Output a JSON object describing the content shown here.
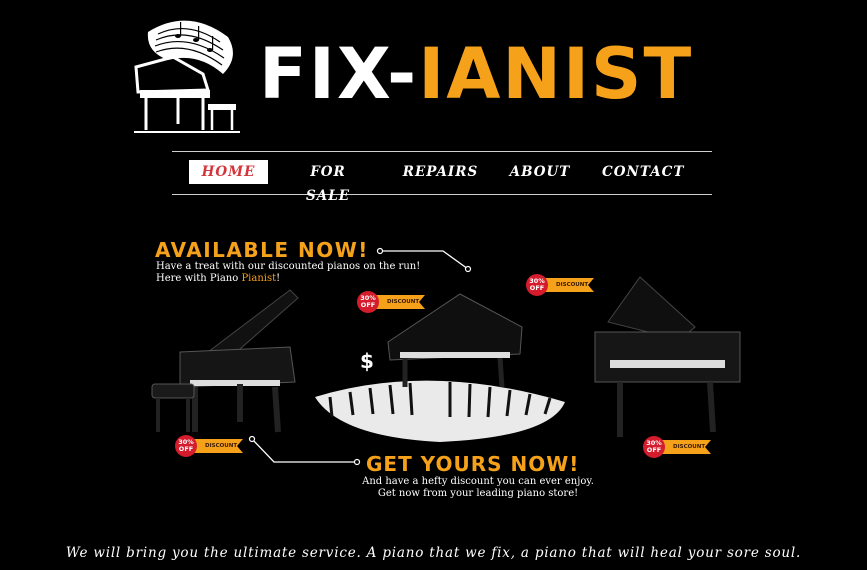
{
  "brand": {
    "part1": "FIX-",
    "part2": "IANIST"
  },
  "colors": {
    "accent": "#f6a11a",
    "active_nav_text": "#d2353a",
    "badge_red": "#d41c2c",
    "background": "#000000"
  },
  "nav": {
    "items": [
      {
        "label": "HOME",
        "active": true
      },
      {
        "label": "FOR SALE",
        "active": false
      },
      {
        "label": "REPAIRS",
        "active": false
      },
      {
        "label": "ABOUT",
        "active": false
      },
      {
        "label": "CONTACT",
        "active": false
      }
    ]
  },
  "banner": {
    "available_title": "AVAILABLE NOW!",
    "available_line1": "Have a treat with our discounted pianos on the run!",
    "available_line2_prefix": "Here with Piano ",
    "available_line2_highlight": "Pianist",
    "available_line2_suffix": "!",
    "get_title": "GET YOURS NOW!",
    "get_line1": "And have a hefty discount you can ever enjoy.",
    "get_line2": "Get now from your leading piano store!",
    "dollar_sign": "$",
    "badge_percent": "30%",
    "badge_off": "OFF",
    "badge_label": "DISCOUNT"
  },
  "tagline": "We will bring you the ultimate service. A piano that we fix, a piano that will heal your sore soul."
}
